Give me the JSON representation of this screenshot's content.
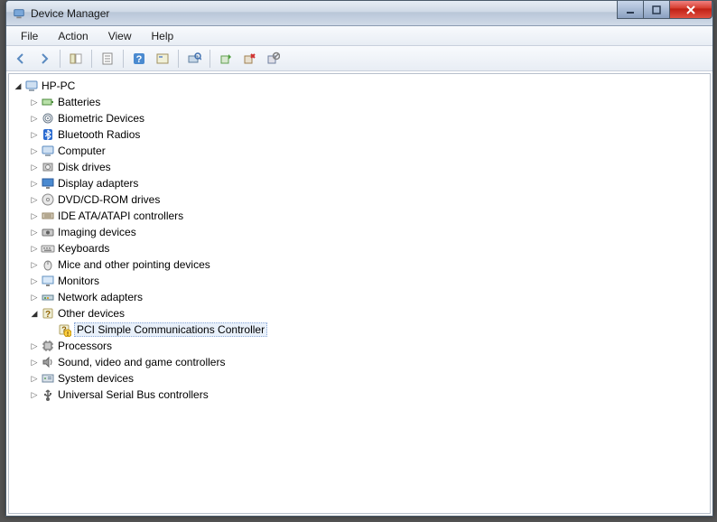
{
  "window": {
    "title": "Device Manager"
  },
  "menu": {
    "file": "File",
    "action": "Action",
    "view": "View",
    "help": "Help"
  },
  "tree": {
    "root": {
      "label": "HP-PC",
      "icon": "computer-icon",
      "expanded": true,
      "children": [
        {
          "label": "Batteries",
          "icon": "battery-icon",
          "expanded": false
        },
        {
          "label": "Biometric Devices",
          "icon": "biometric-icon",
          "expanded": false
        },
        {
          "label": "Bluetooth Radios",
          "icon": "bluetooth-icon",
          "expanded": false
        },
        {
          "label": "Computer",
          "icon": "computer-icon",
          "expanded": false
        },
        {
          "label": "Disk drives",
          "icon": "disk-icon",
          "expanded": false
        },
        {
          "label": "Display adapters",
          "icon": "display-icon",
          "expanded": false
        },
        {
          "label": "DVD/CD-ROM drives",
          "icon": "optical-icon",
          "expanded": false
        },
        {
          "label": "IDE ATA/ATAPI controllers",
          "icon": "ide-icon",
          "expanded": false
        },
        {
          "label": "Imaging devices",
          "icon": "imaging-icon",
          "expanded": false
        },
        {
          "label": "Keyboards",
          "icon": "keyboard-icon",
          "expanded": false
        },
        {
          "label": "Mice and other pointing devices",
          "icon": "mouse-icon",
          "expanded": false
        },
        {
          "label": "Monitors",
          "icon": "monitor-icon",
          "expanded": false
        },
        {
          "label": "Network adapters",
          "icon": "network-icon",
          "expanded": false
        },
        {
          "label": "Other devices",
          "icon": "unknown-icon",
          "expanded": true,
          "children": [
            {
              "label": "PCI Simple Communications Controller",
              "icon": "unknown-warn-icon",
              "leaf": true,
              "selected": true
            }
          ]
        },
        {
          "label": "Processors",
          "icon": "cpu-icon",
          "expanded": false
        },
        {
          "label": "Sound, video and game controllers",
          "icon": "sound-icon",
          "expanded": false
        },
        {
          "label": "System devices",
          "icon": "system-icon",
          "expanded": false
        },
        {
          "label": "Universal Serial Bus controllers",
          "icon": "usb-icon",
          "expanded": false
        }
      ]
    }
  }
}
